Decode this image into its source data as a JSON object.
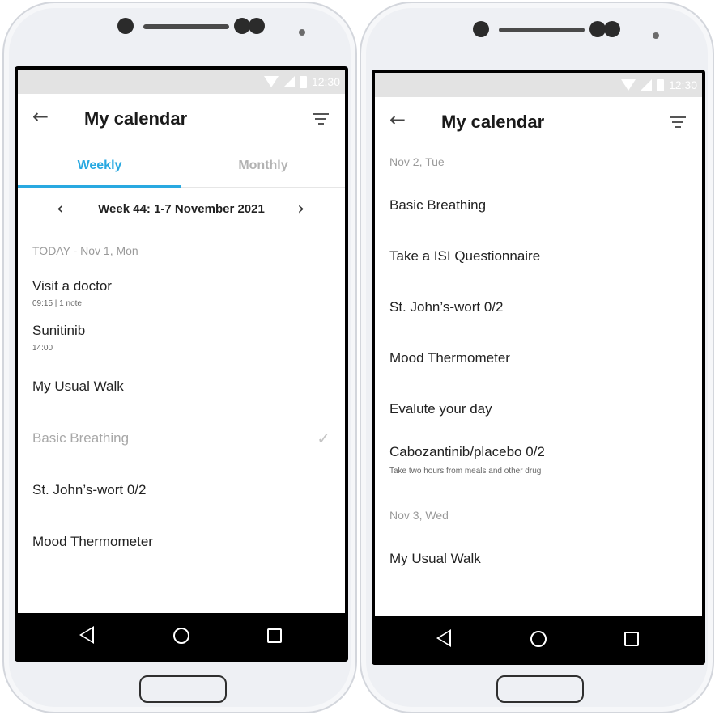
{
  "status": {
    "time": "12:30"
  },
  "left": {
    "title": "My calendar",
    "tabs": {
      "weekly": "Weekly",
      "monthly": "Monthly"
    },
    "week_label": "Week 44: 1-7 November 2021",
    "section": "TODAY - Nov 1, Mon",
    "items": [
      {
        "name": "Visit a doctor",
        "meta": "09:15   |   1 note"
      },
      {
        "name": "Sunitinib",
        "meta": "14:00"
      },
      {
        "name": "My Usual Walk"
      },
      {
        "name": "Basic Breathing",
        "done": true
      },
      {
        "name": "St. John’s-wort 0/2"
      },
      {
        "name": "Mood Thermometer"
      }
    ]
  },
  "right": {
    "title": "My calendar",
    "section1": "Nov 2, Tue",
    "items1": [
      {
        "name": "Basic Breathing"
      },
      {
        "name": "Take a ISI Questionnaire"
      },
      {
        "name": "St. John’s-wort 0/2"
      },
      {
        "name": "Mood Thermometer"
      },
      {
        "name": "Evalute your day"
      },
      {
        "name": "Cabozantinib/placebo 0/2",
        "meta": "Take two hours from meals and other drug"
      }
    ],
    "section2": "Nov 3, Wed",
    "items2": [
      {
        "name": "My Usual Walk"
      }
    ]
  },
  "icons": {
    "back": "arrow-left-icon",
    "filter": "filter-icon",
    "prev_week": "chevron-left-icon",
    "next_week": "chevron-right-icon",
    "check": "check-icon",
    "accent_color": "#29a9e1"
  }
}
